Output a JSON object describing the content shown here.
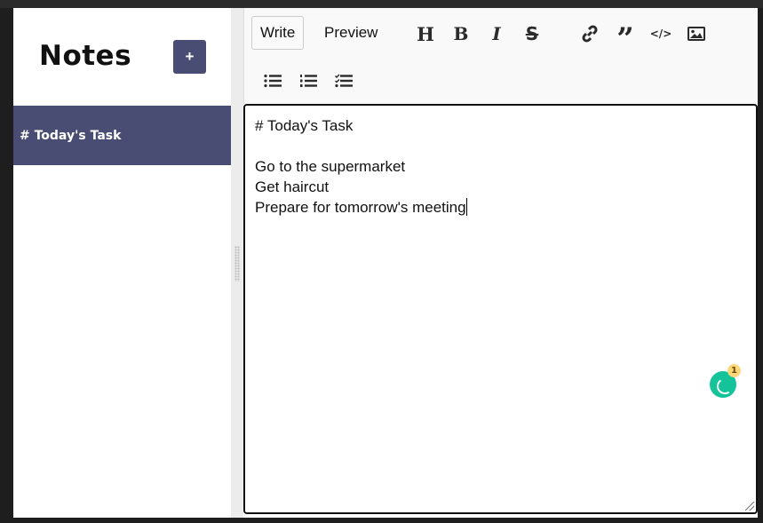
{
  "sidebar": {
    "title": "Notes",
    "add_label": "+",
    "notes": [
      {
        "label": "# Today's Task"
      }
    ]
  },
  "editor": {
    "tabs": [
      {
        "label": "Write",
        "active": true
      },
      {
        "label": "Preview",
        "active": false
      }
    ],
    "toolbar": [
      "heading-icon",
      "bold-icon",
      "italic-icon",
      "strikethrough-icon",
      "link-icon",
      "quote-icon",
      "code-icon",
      "image-icon",
      "unordered-list-icon",
      "ordered-list-icon",
      "checklist-icon"
    ],
    "content": "# Today's Task\n\nGo to the supermarket\nGet haircut\nPrepare for tomorrow's meeting",
    "grammarly_count": "1"
  },
  "colors": {
    "accent": "#4a4d73",
    "grammarly": "#15c39a"
  }
}
